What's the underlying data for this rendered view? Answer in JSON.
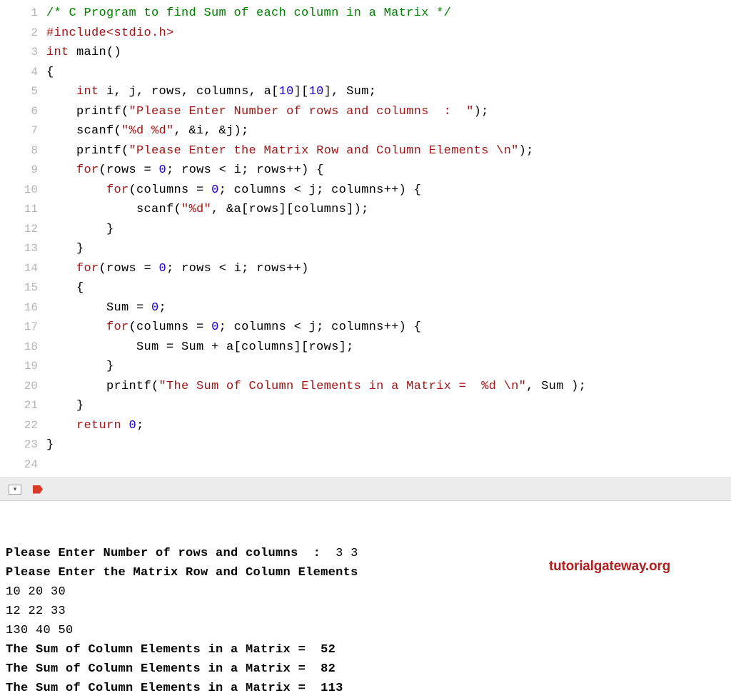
{
  "code": {
    "lines": [
      {
        "n": 1,
        "segs": [
          {
            "t": "/* C Program to find Sum of each column in a Matrix */",
            "c": "c-comment"
          }
        ]
      },
      {
        "n": 2,
        "segs": [
          {
            "t": "#include",
            "c": "c-prep"
          },
          {
            "t": "<stdio.h>",
            "c": "c-include"
          }
        ]
      },
      {
        "n": 3,
        "segs": [
          {
            "t": "int",
            "c": "c-type"
          },
          {
            "t": " main()",
            "c": "c-ident"
          }
        ]
      },
      {
        "n": 4,
        "segs": [
          {
            "t": "{",
            "c": "c-punc"
          }
        ]
      },
      {
        "n": 5,
        "segs": [
          {
            "t": "    ",
            "c": "c-punc"
          },
          {
            "t": "int",
            "c": "c-type"
          },
          {
            "t": " i, j, rows, columns, a[",
            "c": "c-ident"
          },
          {
            "t": "10",
            "c": "c-number"
          },
          {
            "t": "][",
            "c": "c-ident"
          },
          {
            "t": "10",
            "c": "c-number"
          },
          {
            "t": "], Sum;",
            "c": "c-ident"
          }
        ]
      },
      {
        "n": 6,
        "segs": [
          {
            "t": "    printf(",
            "c": "c-ident"
          },
          {
            "t": "\"Please Enter Number of rows and columns  :  \"",
            "c": "c-string"
          },
          {
            "t": ");",
            "c": "c-ident"
          }
        ]
      },
      {
        "n": 7,
        "segs": [
          {
            "t": "    scanf(",
            "c": "c-ident"
          },
          {
            "t": "\"%d %d\"",
            "c": "c-string"
          },
          {
            "t": ", &i, &j);",
            "c": "c-ident"
          }
        ]
      },
      {
        "n": 8,
        "segs": [
          {
            "t": "",
            "c": "c-punc"
          }
        ]
      },
      {
        "n": 9,
        "segs": [
          {
            "t": "    printf(",
            "c": "c-ident"
          },
          {
            "t": "\"Please Enter the Matrix Row and Column Elements \\n\"",
            "c": "c-string"
          },
          {
            "t": ");",
            "c": "c-ident"
          }
        ]
      },
      {
        "n": 10,
        "segs": [
          {
            "t": "    ",
            "c": "c-punc"
          },
          {
            "t": "for",
            "c": "c-keyword"
          },
          {
            "t": "(rows = ",
            "c": "c-ident"
          },
          {
            "t": "0",
            "c": "c-number"
          },
          {
            "t": "; rows < i; rows++) {",
            "c": "c-ident"
          }
        ]
      },
      {
        "n": 11,
        "segs": [
          {
            "t": "        ",
            "c": "c-punc"
          },
          {
            "t": "for",
            "c": "c-keyword"
          },
          {
            "t": "(columns = ",
            "c": "c-ident"
          },
          {
            "t": "0",
            "c": "c-number"
          },
          {
            "t": "; columns < j; columns++) {",
            "c": "c-ident"
          }
        ]
      },
      {
        "n": 12,
        "segs": [
          {
            "t": "            scanf(",
            "c": "c-ident"
          },
          {
            "t": "\"%d\"",
            "c": "c-string"
          },
          {
            "t": ", &a[rows][columns]);",
            "c": "c-ident"
          }
        ]
      },
      {
        "n": 13,
        "segs": [
          {
            "t": "        }",
            "c": "c-punc"
          }
        ]
      },
      {
        "n": 14,
        "segs": [
          {
            "t": "    }",
            "c": "c-punc"
          }
        ]
      },
      {
        "n": 15,
        "segs": [
          {
            "t": "    ",
            "c": "c-punc"
          },
          {
            "t": "for",
            "c": "c-keyword"
          },
          {
            "t": "(rows = ",
            "c": "c-ident"
          },
          {
            "t": "0",
            "c": "c-number"
          },
          {
            "t": "; rows < i; rows++)",
            "c": "c-ident"
          }
        ]
      },
      {
        "n": 16,
        "segs": [
          {
            "t": "    {",
            "c": "c-punc"
          }
        ]
      },
      {
        "n": 17,
        "segs": [
          {
            "t": "        Sum = ",
            "c": "c-ident"
          },
          {
            "t": "0",
            "c": "c-number"
          },
          {
            "t": ";",
            "c": "c-ident"
          }
        ]
      },
      {
        "n": 18,
        "segs": [
          {
            "t": "        ",
            "c": "c-punc"
          },
          {
            "t": "for",
            "c": "c-keyword"
          },
          {
            "t": "(columns = ",
            "c": "c-ident"
          },
          {
            "t": "0",
            "c": "c-number"
          },
          {
            "t": "; columns < j; columns++) {",
            "c": "c-ident"
          }
        ]
      },
      {
        "n": 19,
        "segs": [
          {
            "t": "            Sum = Sum + a[columns][rows];",
            "c": "c-ident"
          }
        ]
      },
      {
        "n": 20,
        "segs": [
          {
            "t": "        }",
            "c": "c-punc"
          }
        ]
      },
      {
        "n": 21,
        "segs": [
          {
            "t": "        printf(",
            "c": "c-ident"
          },
          {
            "t": "\"The Sum of Column Elements in a Matrix =  %d \\n\"",
            "c": "c-string"
          },
          {
            "t": ", Sum );",
            "c": "c-ident"
          }
        ]
      },
      {
        "n": 22,
        "segs": [
          {
            "t": "    }",
            "c": "c-punc"
          }
        ]
      },
      {
        "n": 23,
        "segs": [
          {
            "t": "    ",
            "c": "c-punc"
          },
          {
            "t": "return",
            "c": "c-keyword"
          },
          {
            "t": " ",
            "c": "c-ident"
          },
          {
            "t": "0",
            "c": "c-number"
          },
          {
            "t": ";",
            "c": "c-ident"
          }
        ]
      },
      {
        "n": 24,
        "segs": [
          {
            "t": "}",
            "c": "c-punc"
          }
        ]
      }
    ]
  },
  "console": {
    "lines": [
      {
        "bold": true,
        "text": "Please Enter Number of rows and columns  :  ",
        "suffix": "3 3"
      },
      {
        "bold": true,
        "text": "Please Enter the Matrix Row and Column Elements "
      },
      {
        "bold": false,
        "text": "10 20 30"
      },
      {
        "bold": false,
        "text": "12 22 33"
      },
      {
        "bold": false,
        "text": "130 40 50"
      },
      {
        "bold": true,
        "text": "The Sum of Column Elements in a Matrix =  52 "
      },
      {
        "bold": true,
        "text": "The Sum of Column Elements in a Matrix =  82 "
      },
      {
        "bold": true,
        "text": "The Sum of Column Elements in a Matrix =  113 "
      }
    ]
  },
  "watermark": "tutorialgateway.org"
}
